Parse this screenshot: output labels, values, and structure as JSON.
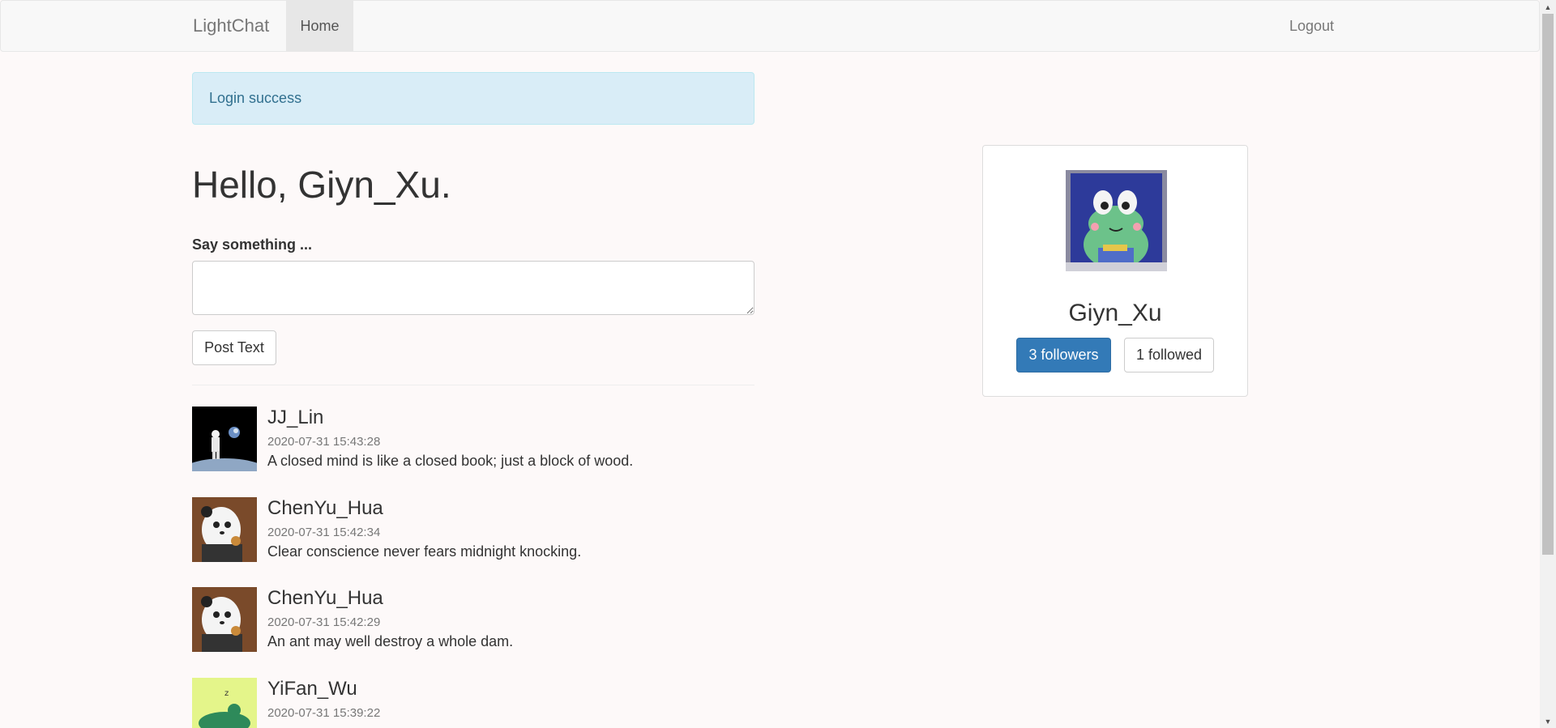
{
  "navbar": {
    "brand": "LightChat",
    "home_label": "Home",
    "logout_label": "Logout"
  },
  "alert": {
    "message": "Login success"
  },
  "greeting": "Hello, Giyn_Xu.",
  "post_form": {
    "label": "Say something ...",
    "input_value": "",
    "submit_label": "Post Text"
  },
  "posts": [
    {
      "author": "JJ_Lin",
      "time": "2020-07-31 15:43:28",
      "body": "A closed mind is like a closed book; just a block of wood.",
      "avatar_icon": "astronaut-avatar-icon"
    },
    {
      "author": "ChenYu_Hua",
      "time": "2020-07-31 15:42:34",
      "body": "Clear conscience never fears midnight knocking.",
      "avatar_icon": "panda-avatar-icon"
    },
    {
      "author": "ChenYu_Hua",
      "time": "2020-07-31 15:42:29",
      "body": "An ant may well destroy a whole dam.",
      "avatar_icon": "panda-avatar-icon"
    },
    {
      "author": "YiFan_Wu",
      "time": "2020-07-31 15:39:22",
      "body": "",
      "avatar_icon": "green-creature-avatar-icon"
    }
  ],
  "profile": {
    "name": "Giyn_Xu",
    "followers_label": "3 followers",
    "followed_label": "1 followed",
    "avatar_icon": "frog-avatar-icon"
  },
  "colors": {
    "primary": "#337ab7",
    "alert_bg": "#d9edf7",
    "alert_text": "#31708f",
    "page_bg": "#fdf9f9"
  }
}
